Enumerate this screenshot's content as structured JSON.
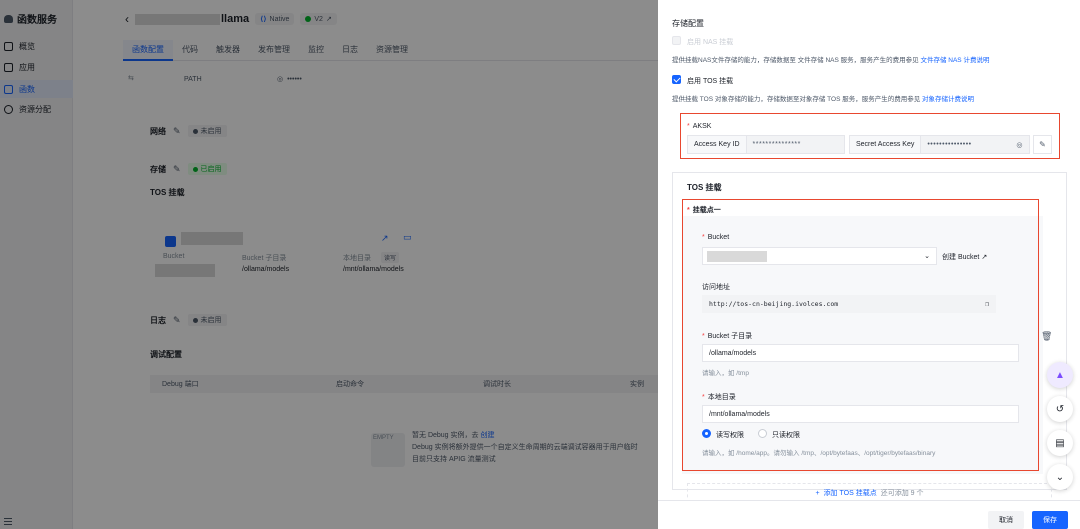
{
  "sidebar": {
    "brand": "函数服务",
    "items": [
      {
        "label": "概览",
        "active": false
      },
      {
        "label": "应用",
        "active": false
      },
      {
        "label": "函数",
        "active": true
      },
      {
        "label": "资源分配",
        "active": false
      }
    ]
  },
  "header": {
    "name_suffix": "llama",
    "runtime_tag": "Native",
    "version_tag": "V2"
  },
  "tabs": [
    "函数配置",
    "代码",
    "触发器",
    "发布管理",
    "监控",
    "日志",
    "资源管理"
  ],
  "env": {
    "key": "PATH",
    "value": "••••••"
  },
  "network": {
    "title": "网络",
    "status": "未启用"
  },
  "storage": {
    "title": "存储",
    "status": "已启用",
    "tos_title": "TOS 挂载"
  },
  "bg_tos_card": {
    "bucket_label": "Bucket",
    "subdir_label": "Bucket 子目录",
    "subdir_value": "/ollama/models",
    "local_label": "本地目录",
    "local_value": "/mnt/ollama/models",
    "perm_tag": "读写"
  },
  "log": {
    "title": "日志",
    "status": "未启用"
  },
  "debug": {
    "title": "调试配置",
    "columns": [
      "Debug 端口",
      "启动命令",
      "调试时长",
      "实例"
    ],
    "empty_line1": "暂无 Debug 实例，去",
    "empty_link": "创建",
    "empty_line2": "Debug 实例将额外提供一个自定义生命周期的云端调试容器用于用户临时",
    "empty_line3": "目前只支持 APIG 流量测试",
    "empty_icon_text": "EMPTY"
  },
  "drawer": {
    "storage_title": "存储配置",
    "nas_label": "启用 NAS 挂载",
    "nas_desc": "提供挂载NAS文件存储的能力，存储数据至 文件存储 NAS 服务，服务产生的费用参见",
    "nas_link": "文件存储 NAS 计费说明",
    "tos_label": "启用 TOS 挂载",
    "tos_desc": "提供挂载 TOS 对象存储的能力，存储数据至对象存储 TOS 服务，服务产生的费用参见",
    "tos_link": "对象存储计费说明",
    "aksk_title": "AKSK",
    "ak_label": "Access Key ID",
    "ak_value": "***************",
    "sk_label": "Secret Access Key",
    "sk_value": "•••••••••••••••",
    "tos_mount_title": "TOS 挂载",
    "mount_point_title": "挂载点一",
    "bucket_label": "Bucket",
    "create_bucket": "创建 Bucket",
    "access_addr_label": "访问地址",
    "access_addr_value": "http://tos-cn-beijing.ivolces.com",
    "subdir_label": "Bucket 子目录",
    "subdir_value": "/ollama/models",
    "subdir_hint": "请输入，如 /tmp",
    "local_label": "本地目录",
    "local_value": "/mnt/ollama/models",
    "perm_rw": "读写权限",
    "perm_ro": "只读权限",
    "local_hint": "请输入，如 /home/app。请勿输入 /tmp、/opt/bytefaas、/opt/tiger/bytefaas/binary",
    "add_mount": "添加 TOS 挂载点",
    "add_mount_hint": "还可添加 9 个",
    "cancel": "取消",
    "save": "保存"
  },
  "colors": {
    "accent": "#1664ff",
    "highlight": "#e8472f",
    "success": "#00b42a"
  }
}
